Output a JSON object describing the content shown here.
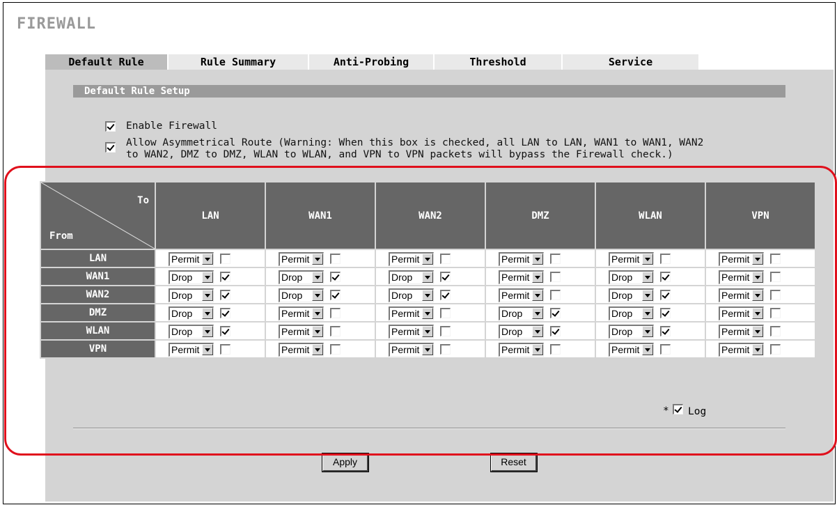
{
  "page": {
    "title": "FIREWALL"
  },
  "tabs": [
    "Default Rule",
    "Rule Summary",
    "Anti-Probing",
    "Threshold",
    "Service"
  ],
  "active_tab": "Default Rule",
  "section": {
    "title": "Default Rule Setup"
  },
  "options": {
    "enable_firewall": {
      "label": "Enable Firewall",
      "checked": true
    },
    "asymmetrical": {
      "line1": "Allow Asymmetrical Route (Warning: When this box is checked, all LAN to LAN, WAN1 to WAN1, WAN2",
      "line2": "to WAN2, DMZ to DMZ, WLAN to WLAN, and VPN to VPN packets will bypass the Firewall check.)",
      "checked": true
    }
  },
  "matrix": {
    "corner_to": "To",
    "corner_from": "From",
    "columns": [
      "LAN",
      "WAN1",
      "WAN2",
      "DMZ",
      "WLAN",
      "VPN"
    ],
    "rows": [
      {
        "label": "LAN",
        "cells": [
          [
            "Permit",
            false
          ],
          [
            "Permit",
            false
          ],
          [
            "Permit",
            false
          ],
          [
            "Permit",
            false
          ],
          [
            "Permit",
            false
          ],
          [
            "Permit",
            false
          ]
        ]
      },
      {
        "label": "WAN1",
        "cells": [
          [
            "Drop",
            true
          ],
          [
            "Drop",
            true
          ],
          [
            "Drop",
            true
          ],
          [
            "Permit",
            false
          ],
          [
            "Drop",
            true
          ],
          [
            "Permit",
            false
          ]
        ]
      },
      {
        "label": "WAN2",
        "cells": [
          [
            "Drop",
            true
          ],
          [
            "Drop",
            true
          ],
          [
            "Drop",
            true
          ],
          [
            "Permit",
            false
          ],
          [
            "Drop",
            true
          ],
          [
            "Permit",
            false
          ]
        ]
      },
      {
        "label": "DMZ",
        "cells": [
          [
            "Drop",
            true
          ],
          [
            "Permit",
            false
          ],
          [
            "Permit",
            false
          ],
          [
            "Drop",
            true
          ],
          [
            "Drop",
            true
          ],
          [
            "Permit",
            false
          ]
        ]
      },
      {
        "label": "WLAN",
        "cells": [
          [
            "Drop",
            true
          ],
          [
            "Permit",
            false
          ],
          [
            "Permit",
            false
          ],
          [
            "Drop",
            true
          ],
          [
            "Drop",
            true
          ],
          [
            "Permit",
            false
          ]
        ]
      },
      {
        "label": "VPN",
        "cells": [
          [
            "Permit",
            false
          ],
          [
            "Permit",
            false
          ],
          [
            "Permit",
            false
          ],
          [
            "Permit",
            false
          ],
          [
            "Permit",
            false
          ],
          [
            "Permit",
            false
          ]
        ]
      }
    ]
  },
  "log": {
    "star": "*",
    "label": "Log",
    "checked": true
  },
  "buttons": {
    "apply": "Apply",
    "reset": "Reset"
  },
  "colors": {
    "header_bg": "#666666",
    "panel_bg": "#d4d4d4",
    "highlight": "#e0101c",
    "title_gray": "#9a9a9a"
  }
}
